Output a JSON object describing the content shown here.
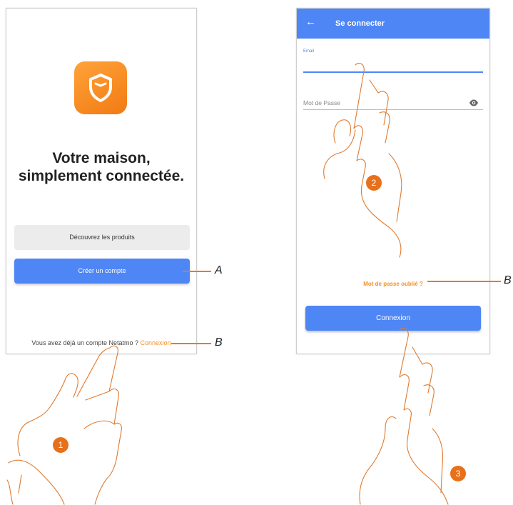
{
  "screen_welcome": {
    "headline_line1": "Votre maison,",
    "headline_line2": "simplement connectée.",
    "discover_button": "Découvrez les produits",
    "create_account_button": "Créer un compte",
    "account_prompt": "Vous avez déjà un compte Netatmo ?",
    "login_link": "Connexion"
  },
  "screen_login": {
    "title": "Se connecter",
    "email_label": "Email",
    "password_placeholder": "Mot de Passe",
    "forgot_password_link": "Mot de passe oublié ?",
    "login_button": "Connexion"
  },
  "callouts": {
    "a": "A",
    "b1": "B",
    "b2": "B"
  },
  "steps": [
    "1",
    "2",
    "3"
  ],
  "colors": {
    "primary_blue": "#4f86f5",
    "accent_orange": "#f7901e",
    "callout_orange": "#f2761a"
  },
  "icons": {
    "logo": "shield-icon",
    "back": "arrow-left-icon",
    "password_visibility": "eye-icon",
    "hands": "pointing-hand-icon"
  }
}
